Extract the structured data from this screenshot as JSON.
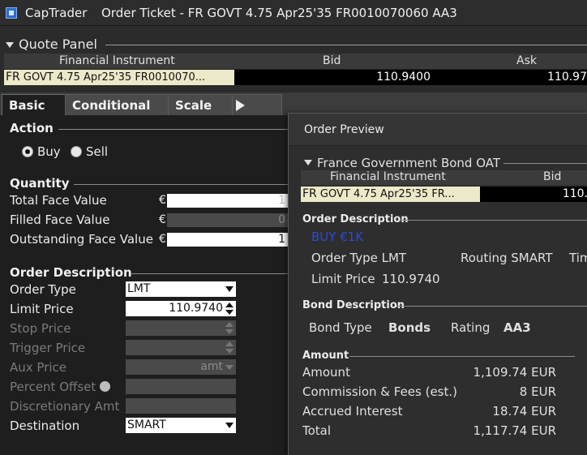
{
  "window": {
    "app": "CapTrader",
    "title": "Order Ticket - FR GOVT 4.75 Apr25'35 FR0010070060 AA3"
  },
  "quote_panel": {
    "title": "Quote Panel",
    "columns": [
      "Financial Instrument",
      "Bid",
      "Ask"
    ],
    "row": {
      "inst_prefix": "FR",
      "inst_rest": "GOVT 4.75 Apr25'35 FR0010070...",
      "bid": "110.9400",
      "ask": "110.97"
    }
  },
  "tabs": [
    "Basic",
    "Conditional",
    "Scale"
  ],
  "action": {
    "title": "Action",
    "buy": "Buy",
    "sell": "Sell"
  },
  "quantity": {
    "title": "Quantity",
    "total_label": "Total Face Value",
    "total_value": "1",
    "filled_label": "Filled Face Value",
    "filled_value": "0",
    "outstanding_label": "Outstanding Face Value",
    "outstanding_value": "1",
    "currency": "€"
  },
  "order_desc": {
    "title": "Order Description",
    "order_type_label": "Order Type",
    "order_type_value": "LMT",
    "limit_price_label": "Limit Price",
    "limit_price_value": "110.9740",
    "stop_price_label": "Stop Price",
    "trigger_price_label": "Trigger Price",
    "aux_price_label": "Aux Price",
    "aux_price_value": "amt",
    "percent_offset_label": "Percent Offset",
    "discretionary_label": "Discretionary Amt",
    "destination_label": "Destination",
    "destination_value": "SMART"
  },
  "preview": {
    "title": "Order Preview",
    "bond_section": "France Government Bond OAT",
    "columns": [
      "Financial Instrument",
      "Bid"
    ],
    "row": {
      "inst_prefix": "FR",
      "inst_rest": "GOVT 4.75 Apr25'35 FR...",
      "bid": "110."
    },
    "order_desc_title": "Order Description",
    "buy_text": "BUY €1K",
    "order_type": "Order Type LMT",
    "routing": "Routing SMART",
    "tim": "Tim",
    "limit_price_label": "Limit Price",
    "limit_price_value": "110.9740",
    "bond_desc_title": "Bond Description",
    "bond_type_label": "Bond Type",
    "bond_type_value": "Bonds",
    "rating_label": "Rating",
    "rating_value": "AA3",
    "amount_title": "Amount",
    "amount_rows": [
      {
        "label": "Amount",
        "value": "1,109.74 EUR"
      },
      {
        "label": "Commission & Fees (est.)",
        "value": "8 EUR"
      },
      {
        "label": "Accrued Interest",
        "value": "18.74 EUR"
      },
      {
        "label": "Total",
        "value": "1,117.74 EUR"
      }
    ]
  }
}
